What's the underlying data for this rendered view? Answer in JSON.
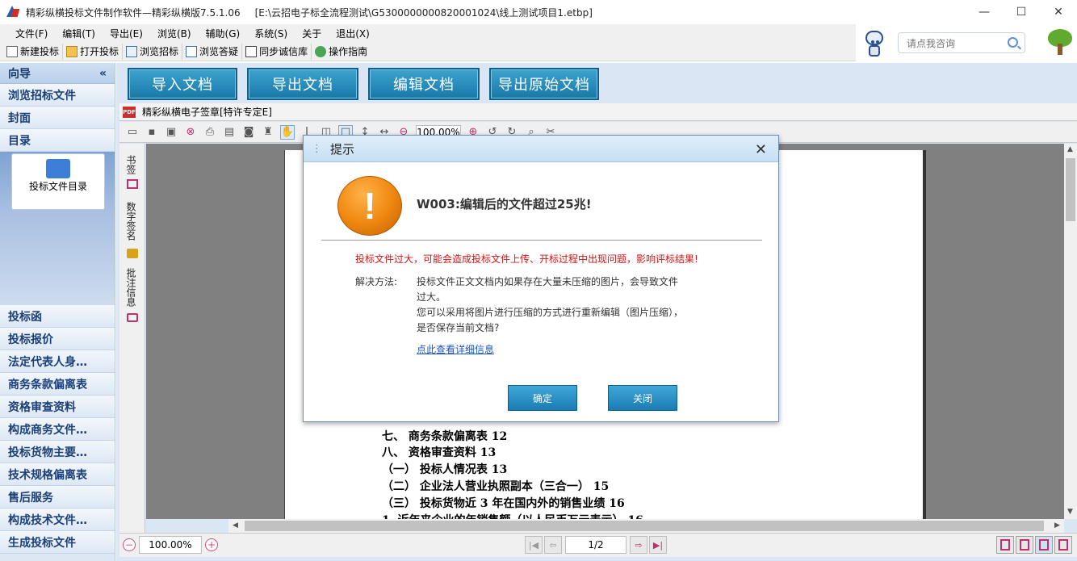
{
  "window": {
    "title": "精彩纵横投标文件制作软件—精彩纵横版7.5.1.06",
    "path": "[E:\\云招电子标全流程测试\\G5300000000820001024\\线上测试项目1.etbp]",
    "minimize": "—",
    "maximize": "☐",
    "close": "✕"
  },
  "menu": [
    "文件(F)",
    "编辑(T)",
    "导出(E)",
    "浏览(B)",
    "辅助(G)",
    "系统(S)",
    "关于",
    "退出(X)"
  ],
  "toolbar": [
    {
      "label": "新建投标",
      "icon": "new-file-icon"
    },
    {
      "label": "打开投标",
      "icon": "open-folder-icon"
    },
    {
      "label": "浏览招标",
      "icon": "browse-icon"
    },
    {
      "label": "浏览答疑",
      "icon": "qa-icon"
    },
    {
      "label": "同步诚信库",
      "icon": "sync-icon"
    },
    {
      "label": "操作指南",
      "icon": "guide-icon"
    }
  ],
  "header_right": {
    "ask_placeholder": "请点我咨询"
  },
  "nav": {
    "title": "向导",
    "collapse": "«",
    "top_items": [
      "浏览招标文件",
      "封面",
      "目录"
    ],
    "card_label": "投标文件目录",
    "bottom_items": [
      "投标函",
      "投标报价",
      "法定代表人身…",
      "商务条款偏离表",
      "资格审查资料",
      "构成商务文件…",
      "投标货物主要…",
      "技术规格偏离表",
      "售后服务",
      "构成技术文件…",
      "生成投标文件"
    ]
  },
  "actions": [
    "导入文档",
    "导出文档",
    "编辑文档",
    "导出原始文档"
  ],
  "doc_tab": {
    "label": "精彩纵横电子签章[特许专定E]",
    "icon_text": "PDF"
  },
  "pdf_toolbar": {
    "zoom": "100.00%"
  },
  "side_tabs": [
    "书签",
    "数字签名",
    "批注信息"
  ],
  "page_lines": [
    "七、  商务条款偏离表   12",
    "八、  资格审查资料 13",
    "（一）  投标人情况表   13",
    "（二）  企业法人营业执照副本（三合一）   15",
    "（三）  投标货物近 3 年在国内外的销售业绩    16",
    "1.  近年来企业的年销售额（以人民币万元表示）    16"
  ],
  "status": {
    "zoom": "100.00%",
    "page": "1/2",
    "zoom_out": "−",
    "zoom_in": "+"
  },
  "dialog": {
    "title": "提示",
    "close": "✕",
    "icon_glyph": "!",
    "headline": "W003:编辑后的文件超过25兆!",
    "warning": "投标文件过大，可能会造成投标文件上传、开标过程中出现问题，影响评标结果!",
    "solution_label": "解决方法:",
    "solution_lines": [
      "投标文件正文文档内如果存在大量未压缩的图片，会导致文件",
      "过大。",
      "您可以采用将图片进行压缩的方式进行重新编辑（图片压缩），",
      "是否保存当前文档?"
    ],
    "link": "点此查看详细信息",
    "ok": "确定",
    "cancel": "关闭"
  },
  "colors": {
    "accent": "#1b7bb4",
    "nav_text": "#1b3f78",
    "warning_text": "#d11414",
    "warn_icon": "#f08a12"
  }
}
